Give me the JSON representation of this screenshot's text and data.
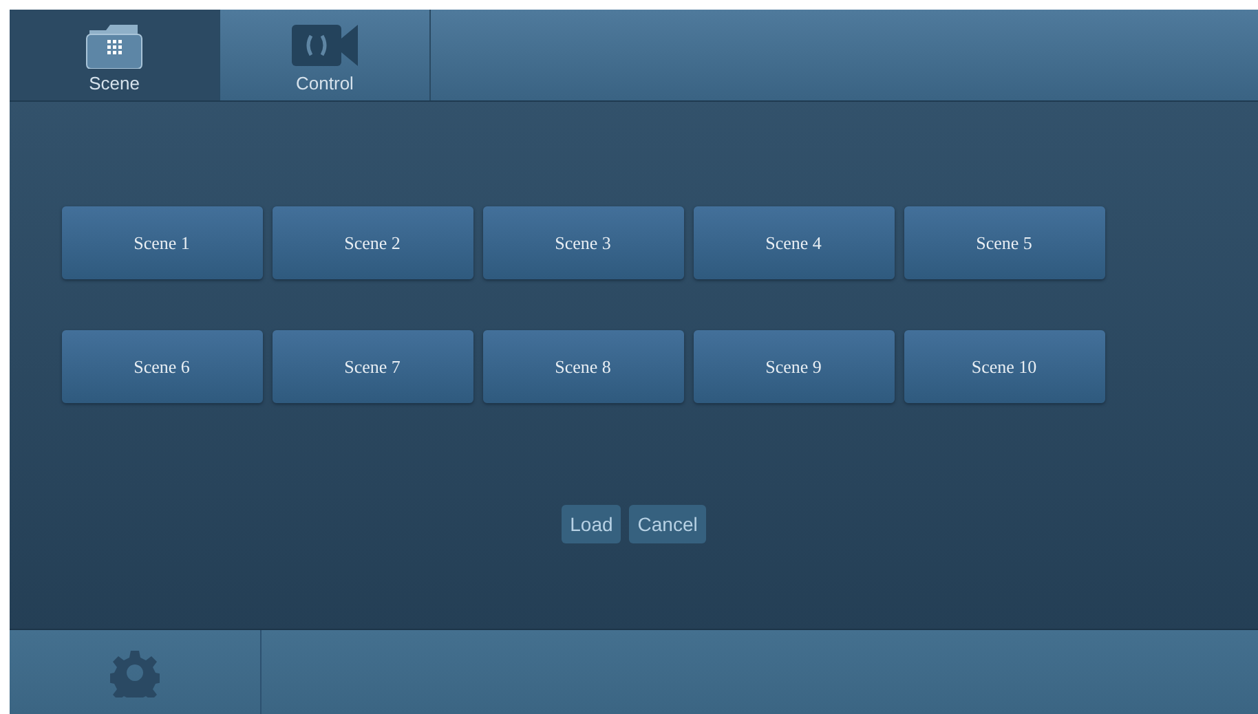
{
  "tabs": [
    {
      "label": "Scene",
      "kind": "folder",
      "selected": true
    },
    {
      "label": "Control",
      "kind": "camera",
      "selected": false
    }
  ],
  "scenes": [
    "Scene 1",
    "Scene 2",
    "Scene 3",
    "Scene 4",
    "Scene 5",
    "Scene 6",
    "Scene 7",
    "Scene 8",
    "Scene 9",
    "Scene 10"
  ],
  "actions": [
    "Load",
    "Cancel"
  ]
}
